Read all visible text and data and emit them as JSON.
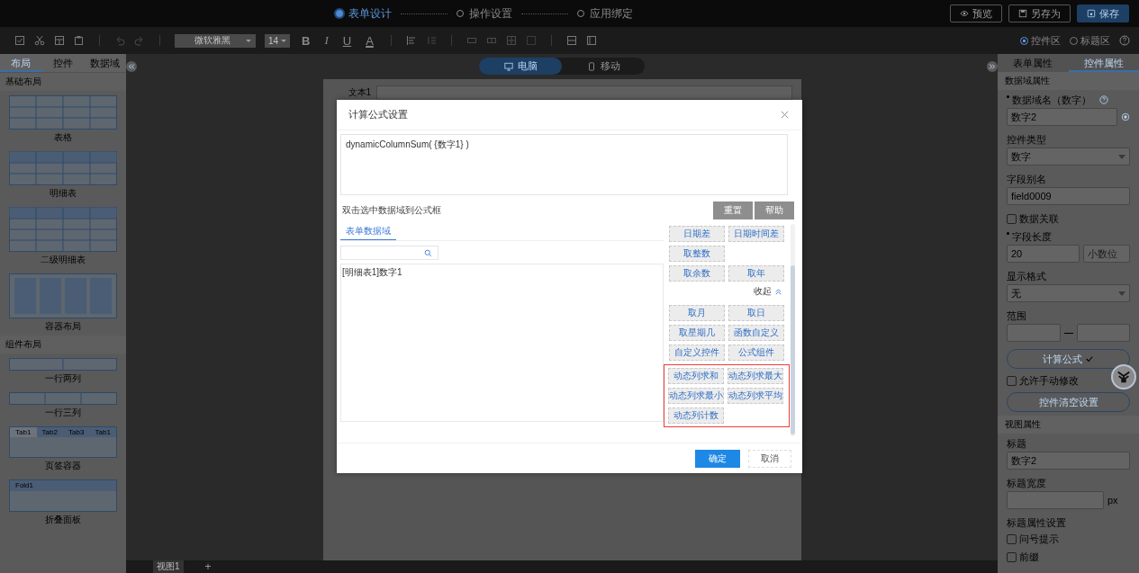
{
  "top_bar": {
    "steps": [
      {
        "label": "表单设计",
        "selected": true
      },
      {
        "label": "操作设置",
        "selected": false
      },
      {
        "label": "应用绑定",
        "selected": false
      }
    ],
    "buttons": [
      {
        "label": "预览",
        "kind": "preview"
      },
      {
        "label": "另存为",
        "kind": "save_as"
      },
      {
        "label": "保存",
        "kind": "save"
      }
    ]
  },
  "toolbar": {
    "font": "微软雅黑",
    "font_size": "14",
    "format_buttons": [
      "B",
      "I",
      "U",
      "A"
    ],
    "zones": [
      {
        "label": "控件区",
        "selected": true
      },
      {
        "label": "标题区",
        "selected": false
      }
    ]
  },
  "left_panel": {
    "tabs": [
      {
        "label": "布局",
        "selected": true
      },
      {
        "label": "控件",
        "selected": false
      },
      {
        "label": "数据域",
        "selected": false
      }
    ],
    "sections": [
      {
        "title": "基础布局",
        "items": [
          {
            "label": "表格",
            "kind": "table"
          },
          {
            "label": "明细表",
            "kind": "detail"
          },
          {
            "label": "二级明细表",
            "kind": "detail2"
          },
          {
            "label": "容器布局",
            "kind": "container"
          }
        ]
      },
      {
        "title": "组件布局",
        "items": [
          {
            "label": "一行两列",
            "kind": "two_col"
          },
          {
            "label": "一行三列",
            "kind": "three_col"
          },
          {
            "label": "页签容器",
            "kind": "tabs",
            "tabs": [
              {
                "label": "Tab1",
                "selected": true
              },
              {
                "label": "Tab2",
                "selected": false
              },
              {
                "label": "Tab3",
                "selected": false
              },
              {
                "label": "Tab1",
                "selected": false
              }
            ]
          },
          {
            "label": "折叠面板",
            "kind": "fold",
            "header": "Fold1"
          }
        ]
      }
    ]
  },
  "canvas": {
    "devices": [
      {
        "label": "电脑",
        "kind": "desktop",
        "selected": true
      },
      {
        "label": "移动",
        "kind": "mobile",
        "selected": false
      }
    ],
    "field_label": "文本1",
    "views": [
      {
        "label": "视图1",
        "selected": true
      }
    ],
    "add_view": "+"
  },
  "dialog": {
    "title": "计算公式设置",
    "formula": "dynamicColumnSum( {数字1} )",
    "hint": "双击选中数据域到公式框",
    "actions": [
      "重置",
      "帮助"
    ],
    "source_tabs": [
      {
        "label": "表单数据域",
        "selected": true
      }
    ],
    "fields": [
      "[明细表1]数字1"
    ],
    "functions": {
      "top_rows": [
        [
          "日期差",
          "日期时间差"
        ],
        [
          "取整数"
        ],
        [
          "取余数",
          "取年"
        ]
      ],
      "collapse_label": "收起",
      "groups": [
        {
          "highlighted": false,
          "rows": [
            [
              "取月",
              "取日"
            ],
            [
              "取星期几",
              "函数自定义"
            ],
            [
              "自定义控件",
              "公式组件"
            ]
          ]
        },
        {
          "highlighted": true,
          "rows": [
            [
              "动态列求和",
              "动态列求最大"
            ],
            [
              "动态列求最小",
              "动态列求平均"
            ],
            [
              "动态列计数"
            ]
          ]
        }
      ]
    },
    "confirm": "确定",
    "cancel": "取消"
  },
  "right_panel": {
    "tabs": [
      {
        "label": "表单属性",
        "selected": false
      },
      {
        "label": "控件属性",
        "selected": true
      }
    ],
    "items": [
      {
        "kind": "section",
        "label": "数据域属性"
      },
      {
        "kind": "label",
        "label": "数据域名（数字）",
        "required": true,
        "help": true
      },
      {
        "kind": "input",
        "value": "数字2",
        "action": true
      },
      {
        "kind": "label",
        "label": "控件类型"
      },
      {
        "kind": "select",
        "value": "数字"
      },
      {
        "kind": "label",
        "label": "字段别名"
      },
      {
        "kind": "input",
        "value": "field0009"
      },
      {
        "kind": "checkbox",
        "label": "数据关联",
        "checked": false
      },
      {
        "kind": "label",
        "label": "字段长度",
        "required": true
      },
      {
        "kind": "pair",
        "value": "20",
        "placeholder": "小数位"
      },
      {
        "kind": "label",
        "label": "显示格式"
      },
      {
        "kind": "select",
        "value": "无"
      },
      {
        "kind": "label",
        "label": "范围"
      },
      {
        "kind": "range"
      },
      {
        "kind": "button",
        "label": "计算公式",
        "check": true
      },
      {
        "kind": "checkbox",
        "label": "允许手动修改",
        "checked": false
      },
      {
        "kind": "button",
        "label": "控件清空设置"
      },
      {
        "kind": "section",
        "label": "视图属性"
      },
      {
        "kind": "label",
        "label": "标题"
      },
      {
        "kind": "input",
        "value": "数字2"
      },
      {
        "kind": "label",
        "label": "标题宽度"
      },
      {
        "kind": "unit",
        "unit": "px"
      },
      {
        "kind": "label",
        "label": "标题属性设置"
      },
      {
        "kind": "checkbox",
        "label": "问号提示",
        "checked": false
      },
      {
        "kind": "checkbox",
        "label": "前缀",
        "checked": false
      }
    ]
  }
}
